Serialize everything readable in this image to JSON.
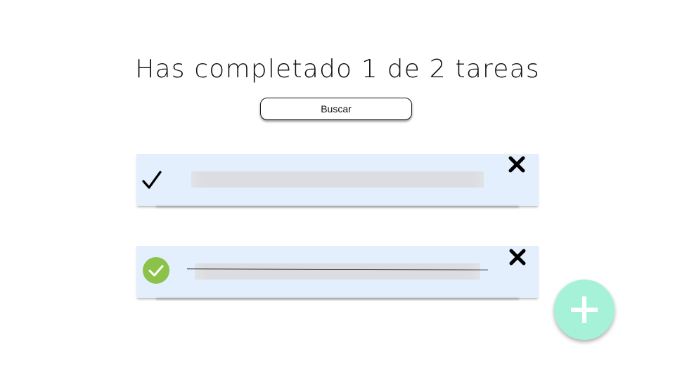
{
  "header": {
    "title": "Has completado 1 de 2 tareas"
  },
  "search": {
    "button_label": "Buscar"
  },
  "tasks": [
    {
      "completed": false,
      "text": "",
      "check_icon": "check-icon",
      "delete_icon": "close-icon"
    },
    {
      "completed": true,
      "text": "",
      "check_icon": "check-circle-icon",
      "delete_icon": "close-icon"
    }
  ],
  "fab": {
    "icon": "plus-icon",
    "color": "#a6f2d8"
  },
  "colors": {
    "card_background": "#e3effd",
    "completed_check": "#8bc34a",
    "text_placeholder": "#dcdde0"
  }
}
